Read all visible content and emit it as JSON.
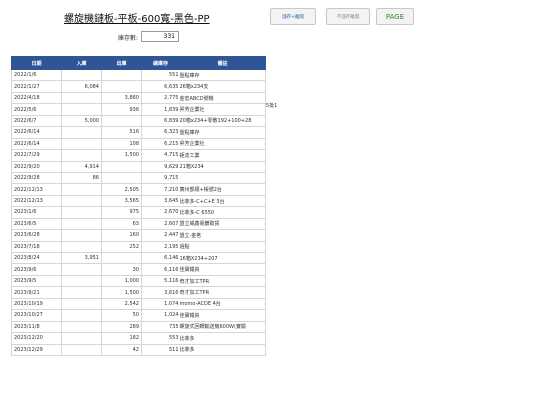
{
  "header": {
    "title": "螺旋機鏈板-平板-600寬-黑色-PP",
    "save_button": "儲存+離開",
    "nosave_button": "不儲存離開",
    "page_button": "PAGE"
  },
  "stock": {
    "label": "庫存數:",
    "value": "331"
  },
  "table": {
    "headers": [
      "日期",
      "入庫",
      "出庫",
      "總庫存",
      "備註"
    ],
    "rows": [
      {
        "date": "2022/1/6",
        "in": "",
        "out": "",
        "balance": "551",
        "note": "盤點庫存"
      },
      {
        "date": "2022/1/27",
        "in": "6,084",
        "out": "",
        "balance": "6,635",
        "note": "26箱x234支"
      },
      {
        "date": "2022/4/18",
        "in": "",
        "out": "3,860",
        "balance": "2,775",
        "note": "金宏ABCD號機"
      },
      {
        "date": "2022/5/6",
        "in": "",
        "out": "936",
        "balance": "1,839",
        "note": "昇芳企業社"
      },
      {
        "date": "2022/6/7",
        "in": "5,000",
        "out": "",
        "balance": "6,839",
        "note": "20箱x234+零散192+100+28"
      },
      {
        "date": "2022/6/14",
        "in": "",
        "out": "516",
        "balance": "6,323",
        "note": "盤點庫存"
      },
      {
        "date": "2022/6/14",
        "in": "",
        "out": "108",
        "balance": "6,215",
        "note": "昇芳企業社"
      },
      {
        "date": "2022/7/29",
        "in": "",
        "out": "1,500",
        "balance": "4,715",
        "note": "鉅達工業"
      },
      {
        "date": "2022/9/20",
        "in": "4,914",
        "out": "",
        "balance": "9,629",
        "note": "21箱X234"
      },
      {
        "date": "2022/9/28",
        "in": "86",
        "out": "",
        "balance": "9,715",
        "note": ""
      },
      {
        "date": "2022/12/13",
        "in": "",
        "out": "2,505",
        "balance": "7,210",
        "note": "廣州部順+帳號2台"
      },
      {
        "date": "2022/12/13",
        "in": "",
        "out": "3,565",
        "balance": "3,645",
        "note": "比菲多-C+C+E 3台"
      },
      {
        "date": "2023/1/6",
        "in": "",
        "out": "975",
        "balance": "2,670",
        "note": "比菲多-C 6550"
      },
      {
        "date": "2023/6/5",
        "in": "",
        "out": "63",
        "balance": "2,607",
        "note": "盟立威鑫電鍍取貨"
      },
      {
        "date": "2023/6/28",
        "in": "",
        "out": "160",
        "balance": "2,447",
        "note": "盟立-金茗"
      },
      {
        "date": "2023/7/18",
        "in": "",
        "out": "252",
        "balance": "2,195",
        "note": "過點"
      },
      {
        "date": "2023/8/24",
        "in": "3,951",
        "out": "",
        "balance": "6,146",
        "note": "16箱X234+207"
      },
      {
        "date": "2023/9/6",
        "in": "",
        "out": "30",
        "balance": "6,116",
        "note": "佳寶鐵資"
      },
      {
        "date": "2023/9/5",
        "in": "",
        "out": "1,000",
        "balance": "5,116",
        "note": "奇才加工TPR"
      },
      {
        "date": "2023/9/21",
        "in": "",
        "out": "1,500",
        "balance": "3,616",
        "note": "奇才加工TPR"
      },
      {
        "date": "2023/10/19",
        "in": "",
        "out": "2,542",
        "balance": "1,074",
        "note": "momo-ACDE 4台"
      },
      {
        "date": "2023/10/27",
        "in": "",
        "out": "50",
        "balance": "1,024",
        "note": "佳寶鐵資"
      },
      {
        "date": "2023/11/8",
        "in": "",
        "out": "289",
        "balance": "735",
        "note": "螺旋式回轉輸送機600W(實驗"
      },
      {
        "date": "2023/12/20",
        "in": "",
        "out": "182",
        "balance": "553",
        "note": "比菲多"
      },
      {
        "date": "2023/12/29",
        "in": "",
        "out": "42",
        "balance": "511",
        "note": "比菲多"
      }
    ]
  },
  "side_note": "5批1"
}
